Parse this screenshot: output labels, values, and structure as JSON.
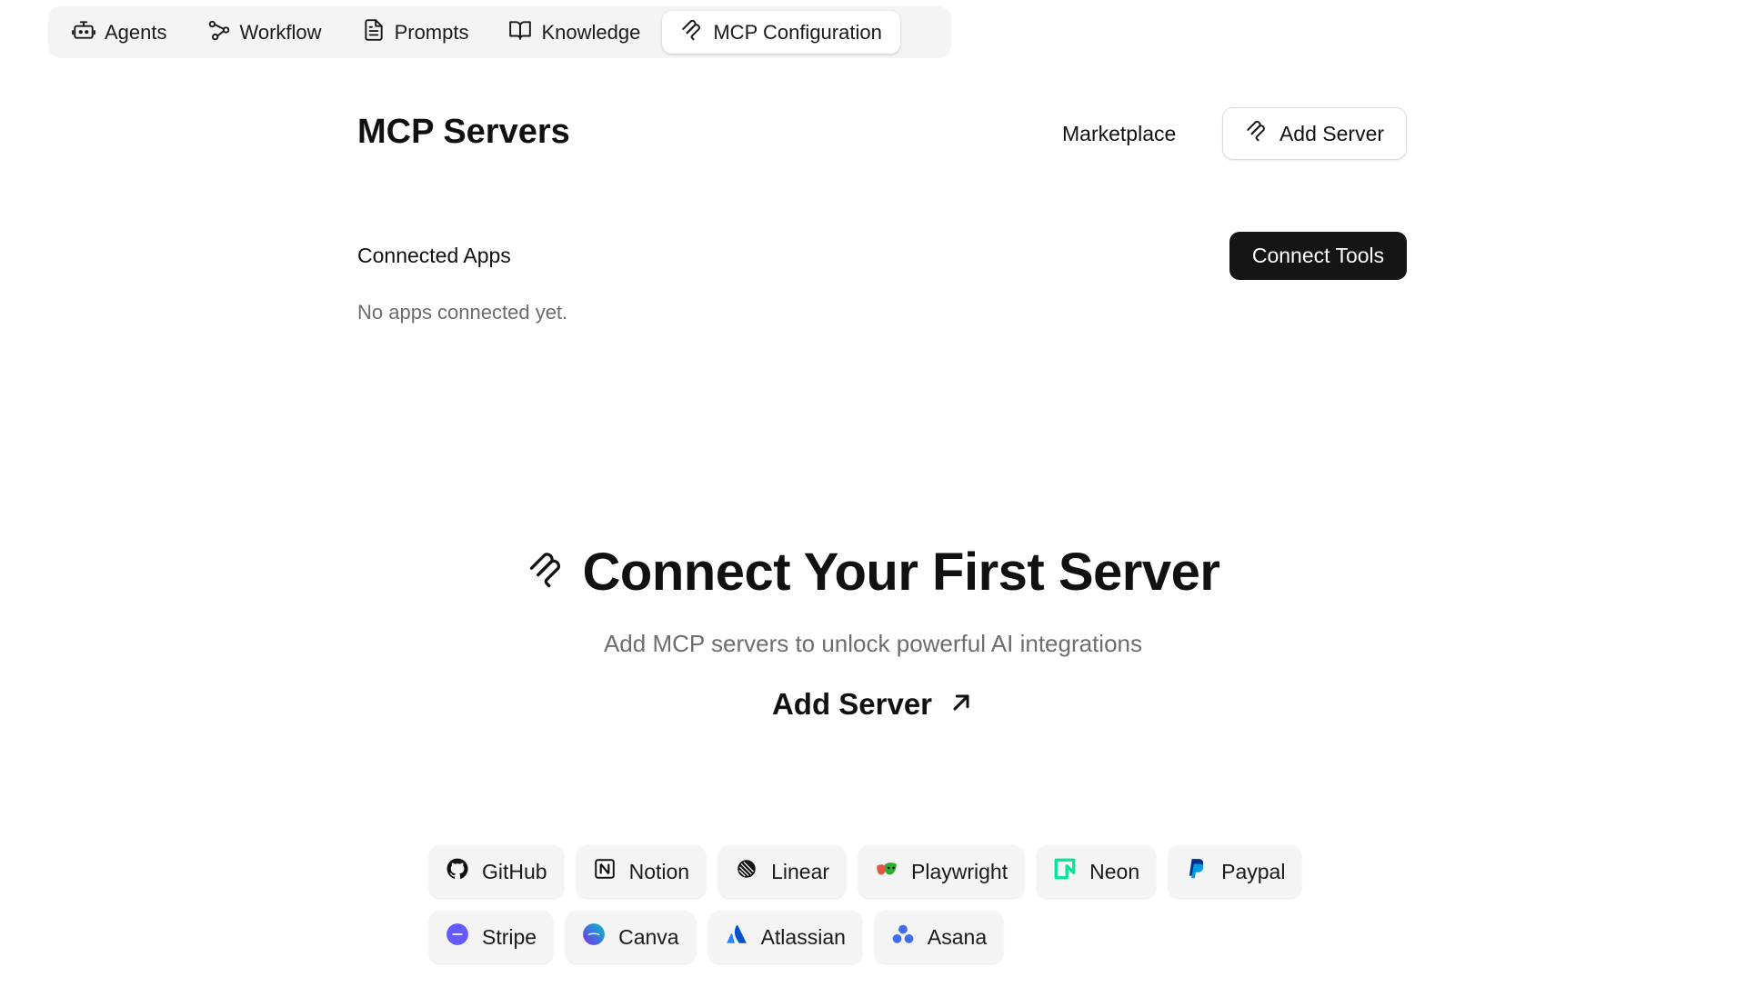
{
  "nav": {
    "tabs": [
      {
        "label": "Agents",
        "icon": "robot-icon",
        "active": false
      },
      {
        "label": "Workflow",
        "icon": "workflow-icon",
        "active": false
      },
      {
        "label": "Prompts",
        "icon": "document-icon",
        "active": false
      },
      {
        "label": "Knowledge",
        "icon": "book-icon",
        "active": false
      },
      {
        "label": "MCP Configuration",
        "icon": "mcp-icon",
        "active": true
      }
    ]
  },
  "header": {
    "title": "MCP Servers",
    "marketplace_label": "Marketplace",
    "add_server_label": "Add Server"
  },
  "connected": {
    "label": "Connected Apps",
    "connect_tools_label": "Connect Tools",
    "empty_text": "No apps connected yet."
  },
  "hero": {
    "title": "Connect Your First Server",
    "subtitle": "Add MCP servers to unlock powerful AI integrations",
    "link_label": "Add Server"
  },
  "integrations": {
    "row1": [
      {
        "label": "GitHub",
        "icon": "github-icon"
      },
      {
        "label": "Notion",
        "icon": "notion-icon"
      },
      {
        "label": "Linear",
        "icon": "linear-icon"
      },
      {
        "label": "Playwright",
        "icon": "playwright-icon"
      },
      {
        "label": "Neon",
        "icon": "neon-icon"
      },
      {
        "label": "Paypal",
        "icon": "paypal-icon"
      }
    ],
    "row2": [
      {
        "label": "Stripe",
        "icon": "stripe-icon"
      },
      {
        "label": "Canva",
        "icon": "canva-icon"
      },
      {
        "label": "Atlassian",
        "icon": "atlassian-icon"
      },
      {
        "label": "Asana",
        "icon": "asana-icon"
      }
    ]
  },
  "colors": {
    "primary_button": "#151515",
    "muted_text": "#6b6b6b",
    "tab_bar_bg": "#f4f4f4",
    "stripe": "#635bff",
    "neon": "#00e599",
    "paypal": "#003087",
    "atlassian": "#2684ff",
    "asana": "#3f6ee8"
  }
}
